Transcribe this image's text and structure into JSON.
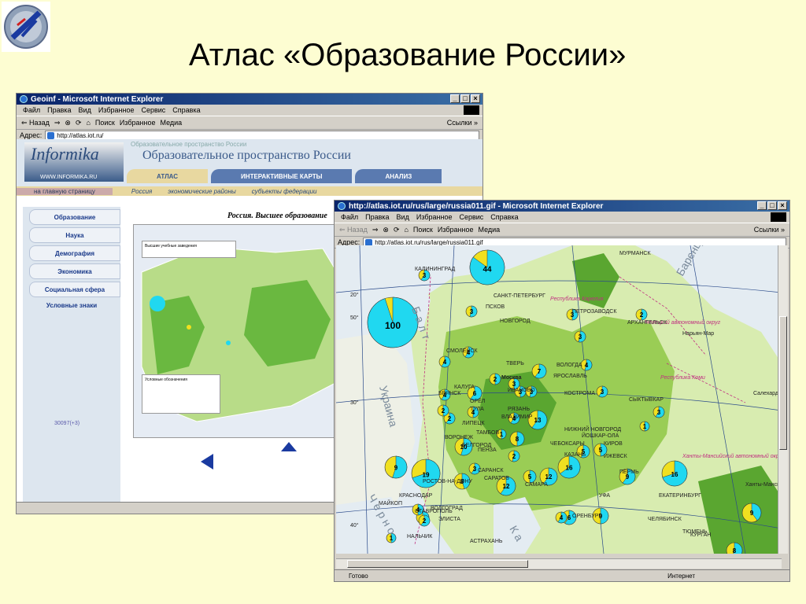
{
  "slide": {
    "title": "Атлас «Образование России»"
  },
  "window_back": {
    "title": "Geoinf - Microsoft Internet Explorer",
    "menu": [
      "Файл",
      "Правка",
      "Вид",
      "Избранное",
      "Сервис",
      "Справка"
    ],
    "toolbar": [
      "⇐ Назад",
      "⇒",
      "Поиск",
      "Избранное",
      "Медиа"
    ],
    "links_label": "Ссылки »",
    "address_label": "Адрес:",
    "address_value": "http://atlas.iot.ru/",
    "logo_text": "Informika",
    "logo_url": "WWW.INFORMIKA.RU",
    "header_sub": "Образовательное пространство России",
    "header_title": "Образовательное пространство России",
    "tabs": [
      "АТЛАС",
      "ИНТЕРАКТИВНЫЕ КАРТЫ",
      "АНАЛИЗ"
    ],
    "subnav": {
      "home": "на главную страницу",
      "items": [
        "Россия",
        "экономические районы",
        "субъекты федерации"
      ]
    },
    "sidebar": [
      "Образование",
      "Наука",
      "Демография",
      "Экономика",
      "Социальная сфера"
    ],
    "sidebar_plain": "Условные знаки",
    "sidebar_count": "30097(+3)",
    "map_title": "Россия. Высшее образование",
    "map_legend": "Высшие учебные заведения",
    "map_legend2": "Условные обозначения"
  },
  "window_front": {
    "title": "http://atlas.iot.ru/rus/large/russia011.gif - Microsoft Internet Explorer",
    "menu": [
      "Файл",
      "Правка",
      "Вид",
      "Избранное",
      "Сервис",
      "Справка"
    ],
    "toolbar": [
      "⇐ Назад",
      "⇒",
      "Поиск",
      "Избранное",
      "Медиа"
    ],
    "links_label": "Ссылки »",
    "address_label": "Адрес:",
    "address_value": "http://atlas.iot.ru/rus/large/russia011.gif",
    "status_left": "Готово",
    "status_right": "Интернет",
    "sea_labels": [
      "Баренцево",
      "Б а л т",
      "Украина",
      "Ч е р н о",
      "К а"
    ],
    "region_labels": [
      "Республика Карелия",
      "Ненецкий автономный округ",
      "Республика Коми",
      "Ханты-Мансийский автономный округ"
    ],
    "cities": [
      "КАЛИНИНГРАД",
      "САНКТ-ПЕТЕРБУРГ",
      "ПСКОВ",
      "НОВГОРОД",
      "ПЕТРОЗАВОДСК",
      "МУРМАНСК",
      "АРХАНГЕЛЬСК",
      "Нарьян-Мар",
      "Салехард",
      "СМОЛЕНСК",
      "ТВЕРЬ",
      "ВОЛОГДА",
      "Москва",
      "ИВАНОВО",
      "КОСТРОМА",
      "ЯРОСЛАВЛЬ",
      "КАЛУГА",
      "БРЯНСК",
      "ОРЁЛ",
      "ТУЛА",
      "РЯЗАНЬ",
      "ВЛАДИМИР",
      "ЛИПЕЦК",
      "ТАМБОВ",
      "ВОРОНЕЖ",
      "БЕЛГОРОД",
      "НИЖНИЙ НОВГОРОД",
      "ЙОШКАР-ОЛА",
      "ЧЕБОКСАРЫ",
      "КАЗАНЬ",
      "ИЖЕВСК",
      "ПЕРМЬ",
      "СЫКТЫВКАР",
      "КИРОВ",
      "САРАНСК",
      "ПЕНЗА",
      "САРАТОВ",
      "САМАРА",
      "УФА",
      "ОРЕНБУРГ",
      "ВОЛГОГРАД",
      "РОСТОВ-НА-ДОНУ",
      "КРАСНОДАР",
      "СТАВРОПОЛЬ",
      "ЭЛИСТА",
      "АСТРАХАНЬ",
      "НАЛЬЧИК",
      "ЕКАТЕРИНБУРГ",
      "ЧЕЛЯБИНСК",
      "КУРГАН",
      "ТЮМЕНЬ",
      "Ханты-Мансийск",
      "МАЙКОП"
    ],
    "lat_labels": [
      "20°",
      "50°",
      "30°",
      "40°"
    ],
    "pies": [
      {
        "label": "100",
        "fraction": 0.95
      },
      {
        "label": "44",
        "fraction": 0.85
      },
      {
        "label": "19",
        "fraction": 0.7
      },
      {
        "label": "16",
        "fraction": 0.7
      },
      {
        "label": "16",
        "fraction": 0.65
      },
      {
        "label": "13",
        "fraction": 0.6
      },
      {
        "label": "12",
        "fraction": 0.6
      },
      {
        "label": "12",
        "fraction": 0.6
      },
      {
        "label": "10",
        "fraction": 0.55
      },
      {
        "label": "9",
        "fraction": 0.4
      },
      {
        "label": "9",
        "fraction": 0.55
      },
      {
        "label": "9",
        "fraction": 0.6
      },
      {
        "label": "9",
        "fraction": 0.5
      },
      {
        "label": "8",
        "fraction": 0.55
      },
      {
        "label": "8",
        "fraction": 0.45
      },
      {
        "label": "8",
        "fraction": 0.5
      },
      {
        "label": "7",
        "fraction": 0.6
      },
      {
        "label": "6",
        "fraction": 0.6
      },
      {
        "label": "6",
        "fraction": 0.6
      },
      {
        "label": "6",
        "fraction": 0.55
      },
      {
        "label": "5",
        "fraction": 0.5
      },
      {
        "label": "5",
        "fraction": 0.5
      },
      {
        "label": "5",
        "fraction": 0.55
      },
      {
        "label": "4",
        "fraction": 0.6
      },
      {
        "label": "4",
        "fraction": 0.6
      },
      {
        "label": "4",
        "fraction": 0.6
      },
      {
        "label": "4",
        "fraction": 0.5
      },
      {
        "label": "4",
        "fraction": 0.55
      },
      {
        "label": "4",
        "fraction": 0.6
      },
      {
        "label": "4",
        "fraction": 0.5
      },
      {
        "label": "4",
        "fraction": 0.6
      },
      {
        "label": "3",
        "fraction": 0.6
      },
      {
        "label": "3",
        "fraction": 0.55
      },
      {
        "label": "3",
        "fraction": 0.5
      },
      {
        "label": "3",
        "fraction": 0.6
      },
      {
        "label": "3",
        "fraction": 0.6
      },
      {
        "label": "3",
        "fraction": 0.55
      },
      {
        "label": "3",
        "fraction": 0.5
      },
      {
        "label": "3",
        "fraction": 0.6
      },
      {
        "label": "3",
        "fraction": 0.55
      },
      {
        "label": "3",
        "fraction": 0.5
      },
      {
        "label": "2",
        "fraction": 0.6
      },
      {
        "label": "2",
        "fraction": 0.55
      },
      {
        "label": "2",
        "fraction": 0.5
      },
      {
        "label": "2",
        "fraction": 0.5
      },
      {
        "label": "2",
        "fraction": 0.55
      },
      {
        "label": "2",
        "fraction": 0.6
      },
      {
        "label": "2",
        "fraction": 0.5
      },
      {
        "label": "1",
        "fraction": 0.5
      },
      {
        "label": "1",
        "fraction": 0.5
      },
      {
        "label": "1",
        "fraction": 0.5
      },
      {
        "label": "1",
        "fraction": 0.5
      }
    ],
    "colors": {
      "pie_cyan": "#20d8f0",
      "pie_yellow": "#f0e020",
      "land_green": "#9acd55",
      "land_dark": "#5aa630",
      "land_light": "#d8ecb0",
      "region_border": "#c03080"
    }
  }
}
